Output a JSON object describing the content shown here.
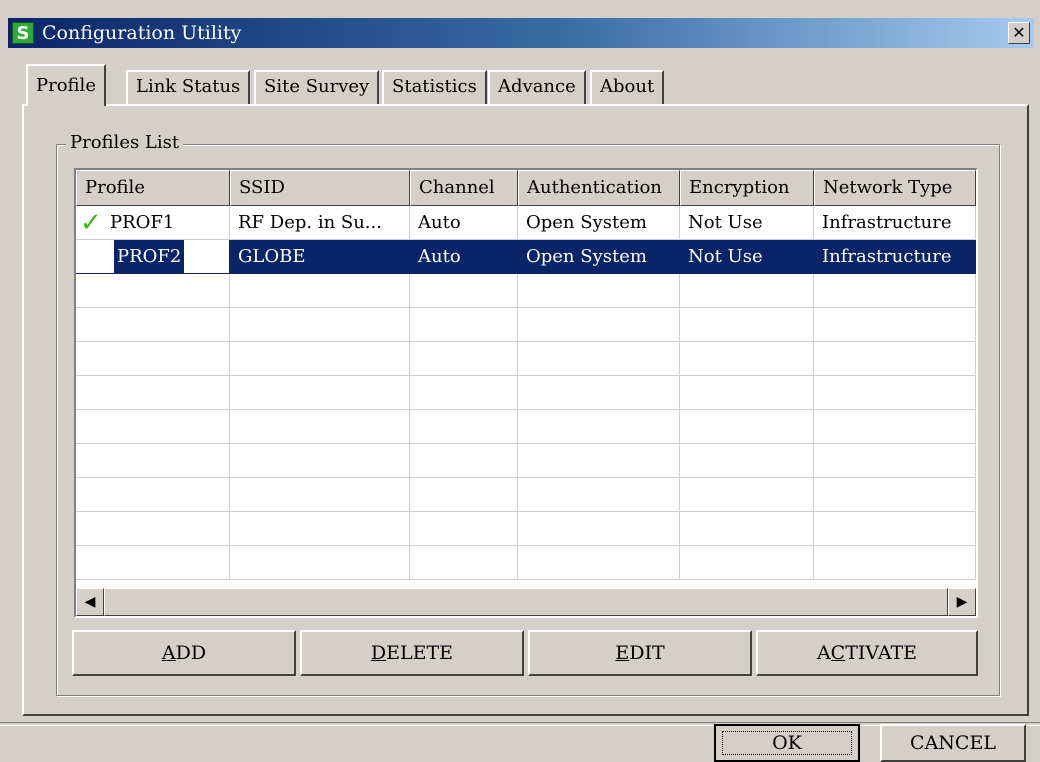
{
  "window": {
    "title": "Configuration Utility",
    "close_glyph": "✕"
  },
  "tabs": [
    {
      "label": "Profile",
      "active": true
    },
    {
      "label": "Link Status",
      "active": false
    },
    {
      "label": "Site Survey",
      "active": false
    },
    {
      "label": "Statistics",
      "active": false
    },
    {
      "label": "Advance",
      "active": false
    },
    {
      "label": "About",
      "active": false
    }
  ],
  "profiles_list": {
    "label": "Profiles List",
    "columns": [
      "Profile",
      "SSID",
      "Channel",
      "Authentication",
      "Encryption",
      "Network Type"
    ],
    "rows": [
      {
        "profile": "PROF1",
        "ssid": "RF Dep. in Su...",
        "channel": "Auto",
        "authentication": "Open System",
        "encryption": "Not Use",
        "network_type": "Infrastructure",
        "active_icon": "checkmark-icon",
        "selected": false
      },
      {
        "profile": "PROF2",
        "ssid": "GLOBE",
        "channel": "Auto",
        "authentication": "Open System",
        "encryption": "Not Use",
        "network_type": "Infrastructure",
        "selected": true
      }
    ]
  },
  "buttons": {
    "add": {
      "label": "ADD",
      "mnemonic": "A"
    },
    "delete": {
      "label": "DELETE",
      "mnemonic": "D"
    },
    "edit": {
      "label": "EDIT",
      "mnemonic": "E"
    },
    "activate": {
      "label": "ACTIVATE",
      "mnemonic": "C"
    },
    "ok": "OK",
    "cancel": "CANCEL"
  },
  "scrollbar": {
    "left_glyph": "◀",
    "right_glyph": "▶"
  },
  "colors": {
    "selection": "#0a246a",
    "titlebar": "#0a246a",
    "check": "#3cb517",
    "app_icon": "#2faa3a"
  }
}
